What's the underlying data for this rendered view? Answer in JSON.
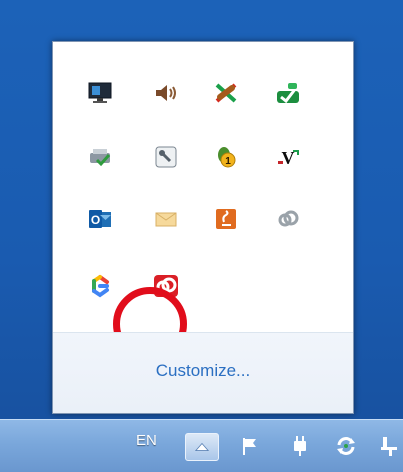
{
  "flyout": {
    "customize_label": "Customize...",
    "icons": [
      {
        "name": "monitor-icon"
      },
      {
        "name": "speaker-icon"
      },
      {
        "name": "network-tools-icon"
      },
      {
        "name": "green-checkmark-icon"
      },
      {
        "name": "printer-check-icon"
      },
      {
        "name": "wrench-icon"
      },
      {
        "name": "update-notification-icon",
        "badge": "1"
      },
      {
        "name": "v-app-icon",
        "text": "V"
      },
      {
        "name": "outlook-icon",
        "text": "O"
      },
      {
        "name": "mail-envelope-icon"
      },
      {
        "name": "java-icon"
      },
      {
        "name": "creative-cloud-gray-icon"
      },
      {
        "name": "google-workspace-icon"
      },
      {
        "name": "adobe-creative-cloud-icon"
      }
    ]
  },
  "taskbar": {
    "language": "EN"
  },
  "colors": {
    "highlight": "#e10d1b",
    "link": "#2b6fc2"
  }
}
